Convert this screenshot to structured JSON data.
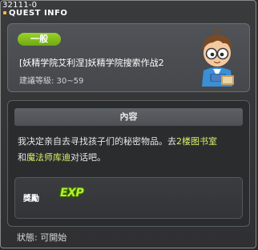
{
  "window": {
    "id": "32111-0",
    "title": "QUEST INFO"
  },
  "quest": {
    "category_badge": "一般",
    "name": "[妖精学院艾利涅]妖精学院搜索作战2",
    "level_range": "建議等級: 30~59"
  },
  "content": {
    "heading": "內容",
    "desc_part1": "我决定亲自去寻找孩子们的秘密物品。去",
    "desc_highlight1": "2楼图书室",
    "desc_part2": "和",
    "desc_highlight2": "魔法师库迪",
    "desc_part3": "对话吧。"
  },
  "reward": {
    "label": "獎勵",
    "item": "EXP"
  },
  "footer": {
    "status": "狀態: 可開始"
  },
  "colors": {
    "badge": "#8cc524",
    "highlight": "#d9f26a",
    "accent": "#f2c230"
  },
  "icons": {
    "npc": "boy-with-glasses-npc",
    "title_marker": "yellow-square"
  }
}
